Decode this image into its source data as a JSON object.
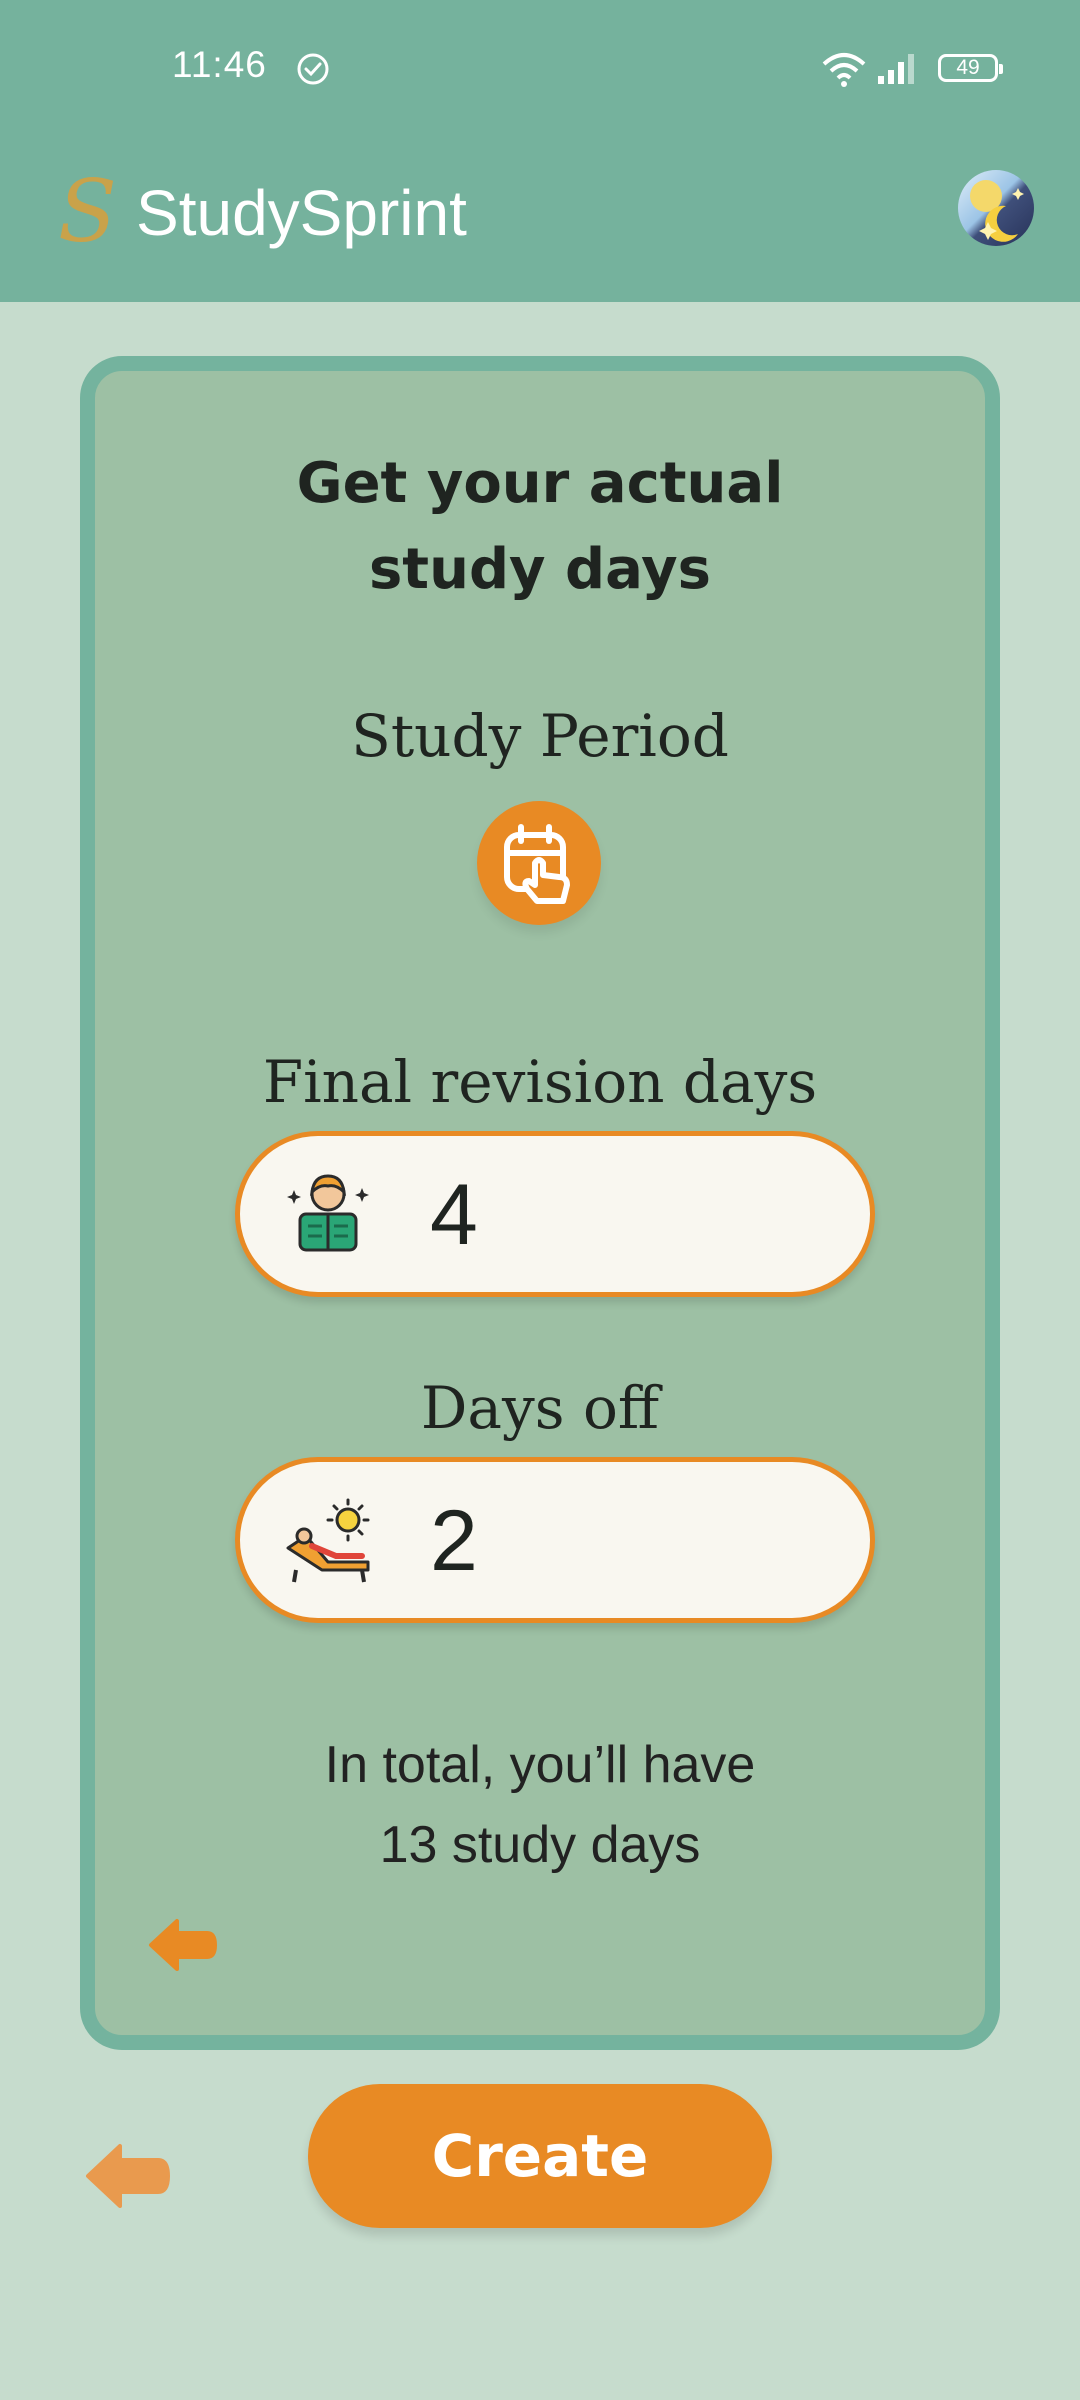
{
  "status_bar": {
    "time": "11:46",
    "battery": "49"
  },
  "app_bar": {
    "logo_letter": "S",
    "title": "StudySprint"
  },
  "card": {
    "title_line1": "Get your actual",
    "title_line2": "study days",
    "study_period_label": "Study Period",
    "final_revision_label": "Final revision days",
    "final_revision_value": "4",
    "days_off_label": "Days off",
    "days_off_value": "2",
    "summary_line1": "In total, you’ll have",
    "summary_line2": "13 study days"
  },
  "footer": {
    "create_label": "Create"
  },
  "colors": {
    "accent": "#e88a24",
    "bar": "#75b29d",
    "card": "#9dc0a4",
    "background": "#c6dccd"
  },
  "icons": [
    "check-circle-icon",
    "wifi-icon",
    "signal-icon",
    "battery-icon",
    "theme-toggle-icon",
    "calendar-touch-icon",
    "reading-person-icon",
    "sunbathing-icon",
    "back-arrow-icon"
  ]
}
